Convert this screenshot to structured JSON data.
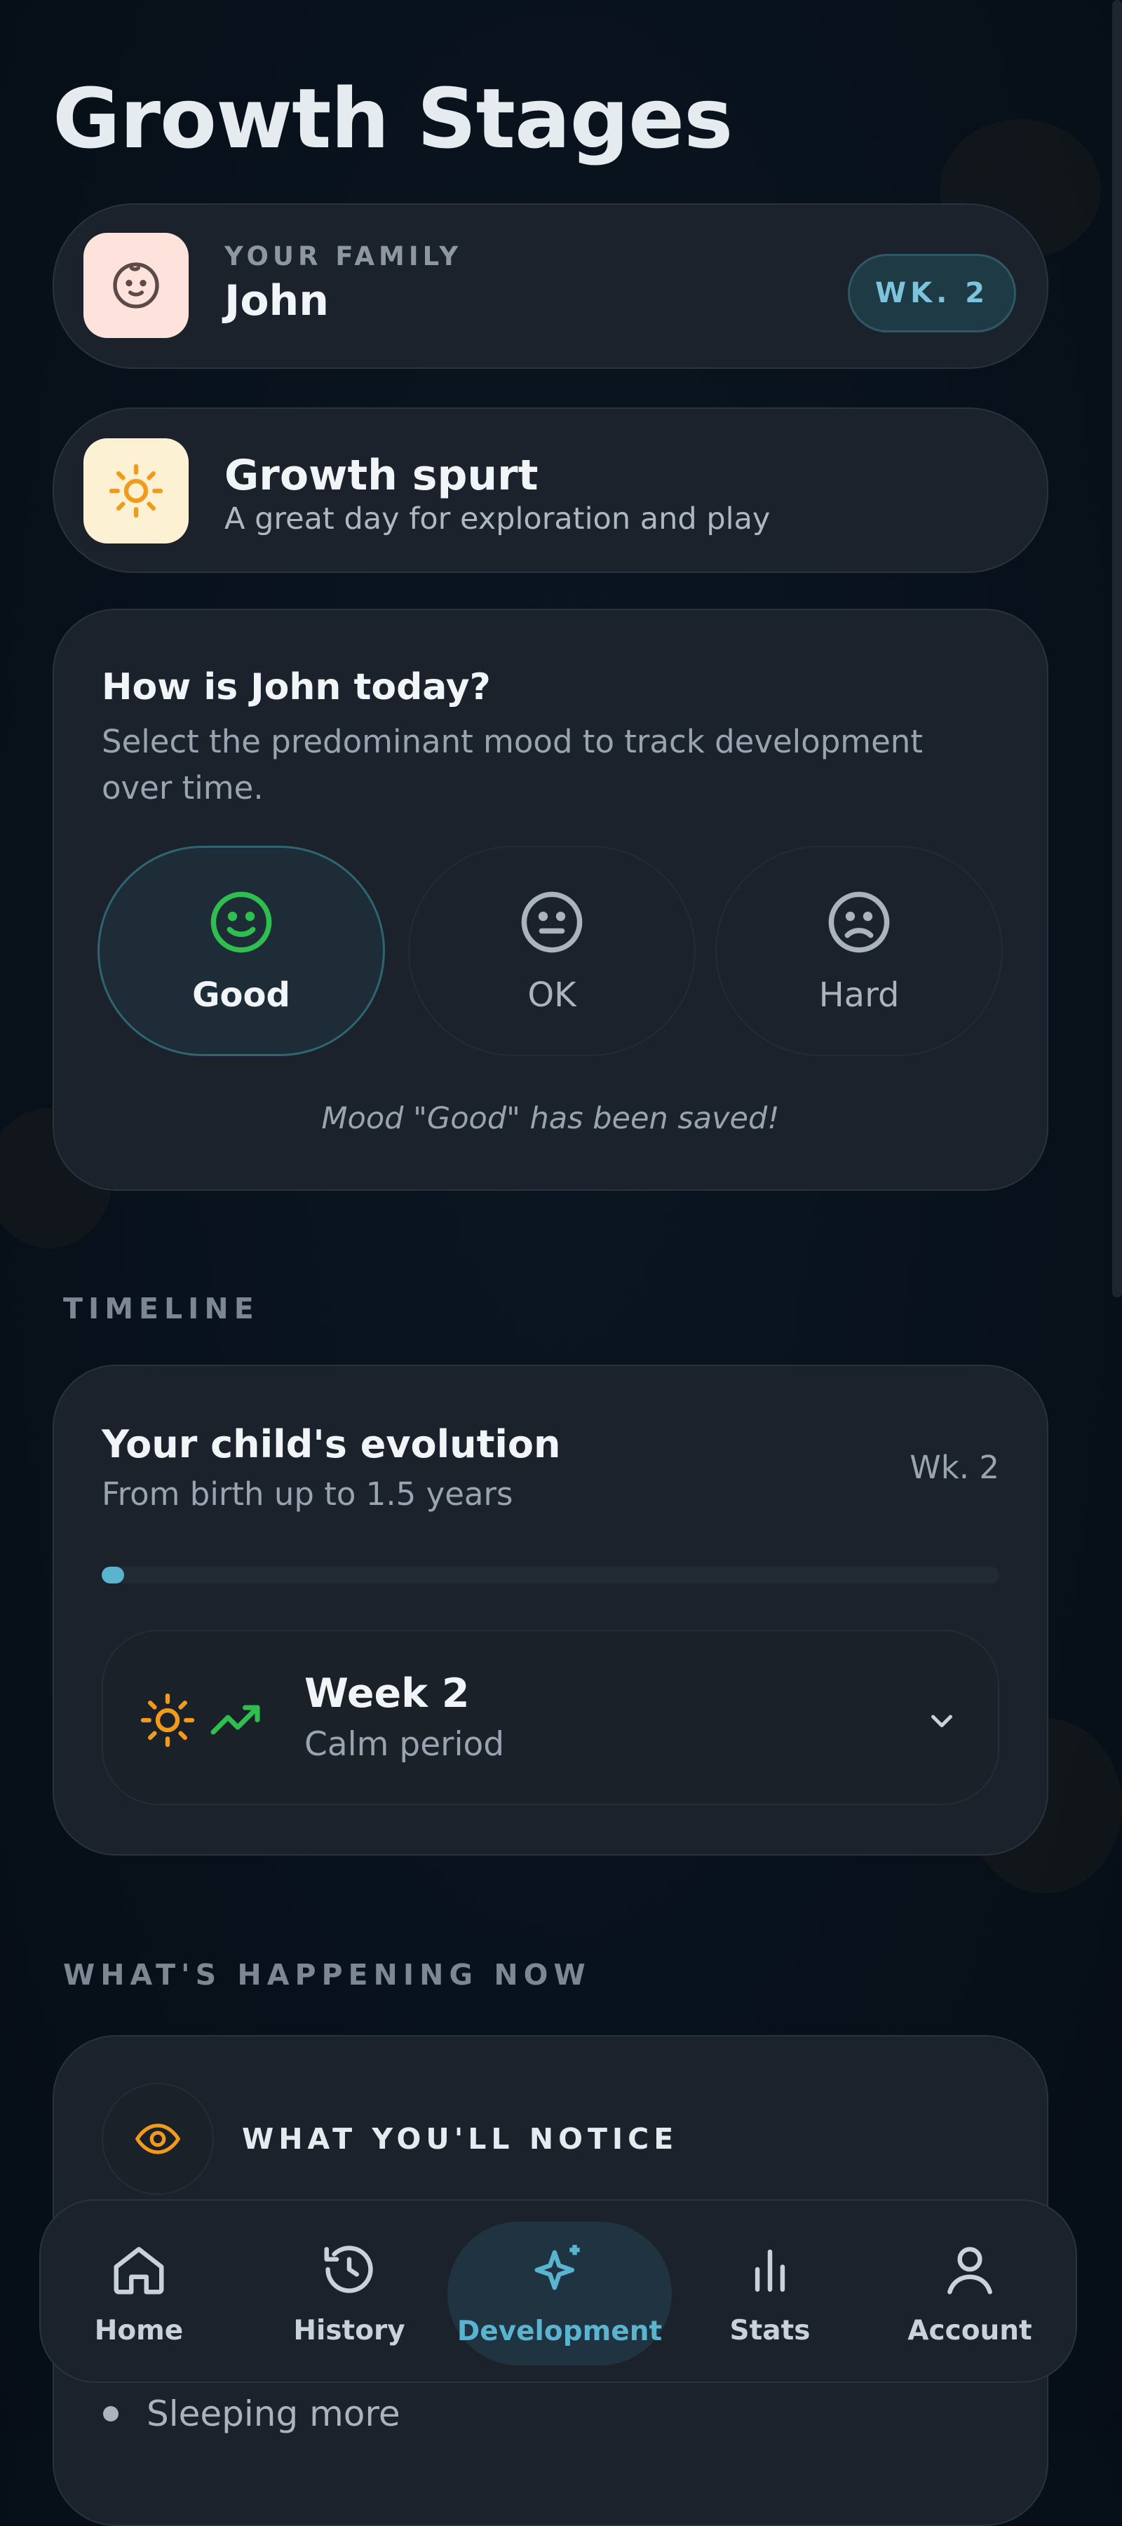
{
  "page": {
    "title": "Growth Stages"
  },
  "family": {
    "kicker": "YOUR FAMILY",
    "name": "John",
    "week_badge": "WK. 2",
    "icon": "baby-face-icon"
  },
  "spurt": {
    "title": "Growth spurt",
    "subtitle": "A great day for exploration and play",
    "icon": "sun-icon"
  },
  "mood": {
    "title": "How is John today?",
    "description": "Select the predominant mood to track development over time.",
    "options": [
      {
        "label": "Good",
        "icon": "smile-icon",
        "selected": true
      },
      {
        "label": "OK",
        "icon": "neutral-face-icon",
        "selected": false
      },
      {
        "label": "Hard",
        "icon": "frown-icon",
        "selected": false
      }
    ],
    "saved_message": "Mood \"Good\" has been saved!"
  },
  "timeline": {
    "section_label": "TIMELINE",
    "title": "Your child's evolution",
    "subtitle": "From birth up to 1.5 years",
    "week": "Wk. 2",
    "progress": 0.025,
    "week_row": {
      "title": "Week 2",
      "subtitle": "Calm period",
      "icons": [
        "sun-icon",
        "trend-up-icon"
      ]
    }
  },
  "happening": {
    "section_label": "WHAT'S HAPPENING NOW",
    "notice_title": "WHAT YOU'LL NOTICE",
    "items": [
      "Sleeping more"
    ]
  },
  "nav": {
    "items": [
      {
        "label": "Home",
        "icon": "home-icon"
      },
      {
        "label": "History",
        "icon": "history-icon"
      },
      {
        "label": "Development",
        "icon": "sparkle-icon",
        "active": true
      },
      {
        "label": "Stats",
        "icon": "bar-chart-icon"
      },
      {
        "label": "Account",
        "icon": "user-icon"
      }
    ]
  },
  "colors": {
    "accent": "#5ab3cf",
    "good": "#2fbf4f",
    "sun": "#f29a1b",
    "card": "#1c222b",
    "background": "#08111b"
  }
}
